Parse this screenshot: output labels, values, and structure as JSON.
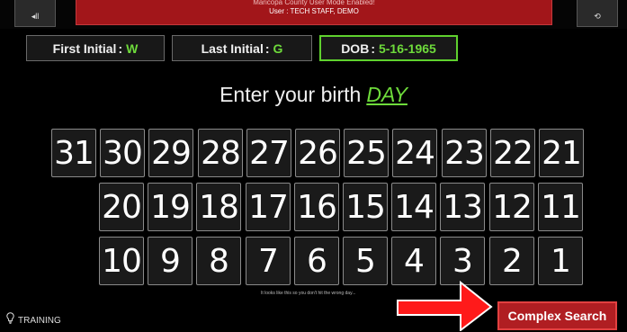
{
  "header": {
    "left_button_icon": "volume-icon",
    "left_button_label": "◂ll",
    "banner_line1": "Maricopa County User Mode Enabled!",
    "banner_line2": "User : TECH STAFF, DEMO",
    "right_button_icon": "refresh-icon",
    "right_button_label": "⟲"
  },
  "selections": {
    "first_initial_label": "First Initial",
    "first_initial_value": "W",
    "last_initial_label": "Last Initial",
    "last_initial_value": "G",
    "dob_label": "DOB",
    "dob_value": "5-16-1965",
    "separator": ":"
  },
  "prompt": {
    "text": "Enter your birth",
    "highlight": "DAY"
  },
  "days": {
    "row1": [
      "31",
      "30",
      "29",
      "28",
      "27",
      "26",
      "25",
      "24",
      "23",
      "22",
      "21"
    ],
    "row2": [
      "20",
      "19",
      "18",
      "17",
      "16",
      "15",
      "14",
      "13",
      "12",
      "11"
    ],
    "row3": [
      "10",
      "9",
      "8",
      "7",
      "6",
      "5",
      "4",
      "3",
      "2",
      "1"
    ]
  },
  "hint": "It looks like this so you don't hit the wrong day...",
  "footer": {
    "training_label": "TRAINING",
    "complex_search_label": "Complex Search"
  },
  "colors": {
    "accent_green": "#6edb3b",
    "banner_red": "#a2161a",
    "arrow_red": "#ff1a1a"
  }
}
